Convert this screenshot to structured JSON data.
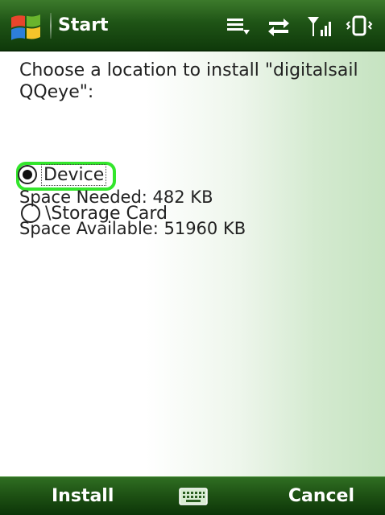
{
  "titlebar": {
    "title": "Start",
    "start_icon": "windows-flag-icon",
    "status_icons": [
      "notification-icon",
      "sync-icon",
      "signal-icon",
      "vibrate-icon"
    ]
  },
  "dialog": {
    "prompt": "Choose a location to install \"digitalsail QQeye\":",
    "options": [
      {
        "label": "Device",
        "selected": true,
        "focused": true
      },
      {
        "label": "\\Storage Card",
        "selected": false,
        "focused": false
      }
    ],
    "space_needed": "Space Needed:  482 KB",
    "space_available": "Space Available: 51960 KB"
  },
  "softkeys": {
    "left": "Install",
    "right": "Cancel",
    "center_icon": "keyboard-icon"
  },
  "colors": {
    "bar_green": "#1f5416",
    "focus_green": "#33e62c"
  }
}
